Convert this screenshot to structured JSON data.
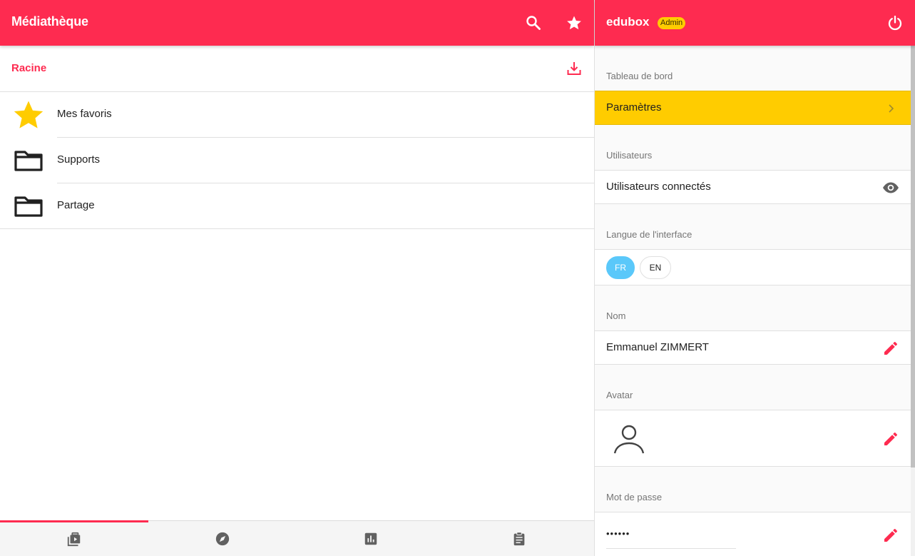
{
  "left": {
    "title": "Médiathèque",
    "breadcrumb": "Racine",
    "items": [
      {
        "label": "Mes favoris",
        "icon": "star-icon"
      },
      {
        "label": "Supports",
        "icon": "folder-icon"
      },
      {
        "label": "Partage",
        "icon": "folder-icon"
      }
    ],
    "bottom_nav": [
      {
        "icon": "media-library-icon",
        "active": true
      },
      {
        "icon": "compass-icon",
        "active": false
      },
      {
        "icon": "bar-chart-icon",
        "active": false
      },
      {
        "icon": "clipboard-icon",
        "active": false
      }
    ]
  },
  "right": {
    "title": "edubox",
    "badge": "Admin",
    "sections": {
      "dashboard": "Tableau de bord",
      "settings": "Paramètres",
      "users": "Utilisateurs",
      "connected_users": "Utilisateurs connectés",
      "language": "Langue de l'interface",
      "lang_fr": "FR",
      "lang_en": "EN",
      "name_label": "Nom",
      "name_value": "Emmanuel ZIMMERT",
      "avatar_label": "Avatar",
      "password_label": "Mot de passe",
      "password_value": "••••••"
    }
  },
  "colors": {
    "primary": "#fe2b50",
    "highlight": "#ffcc00",
    "lang_active": "#5ac8fa",
    "star": "#ffcc00"
  }
}
